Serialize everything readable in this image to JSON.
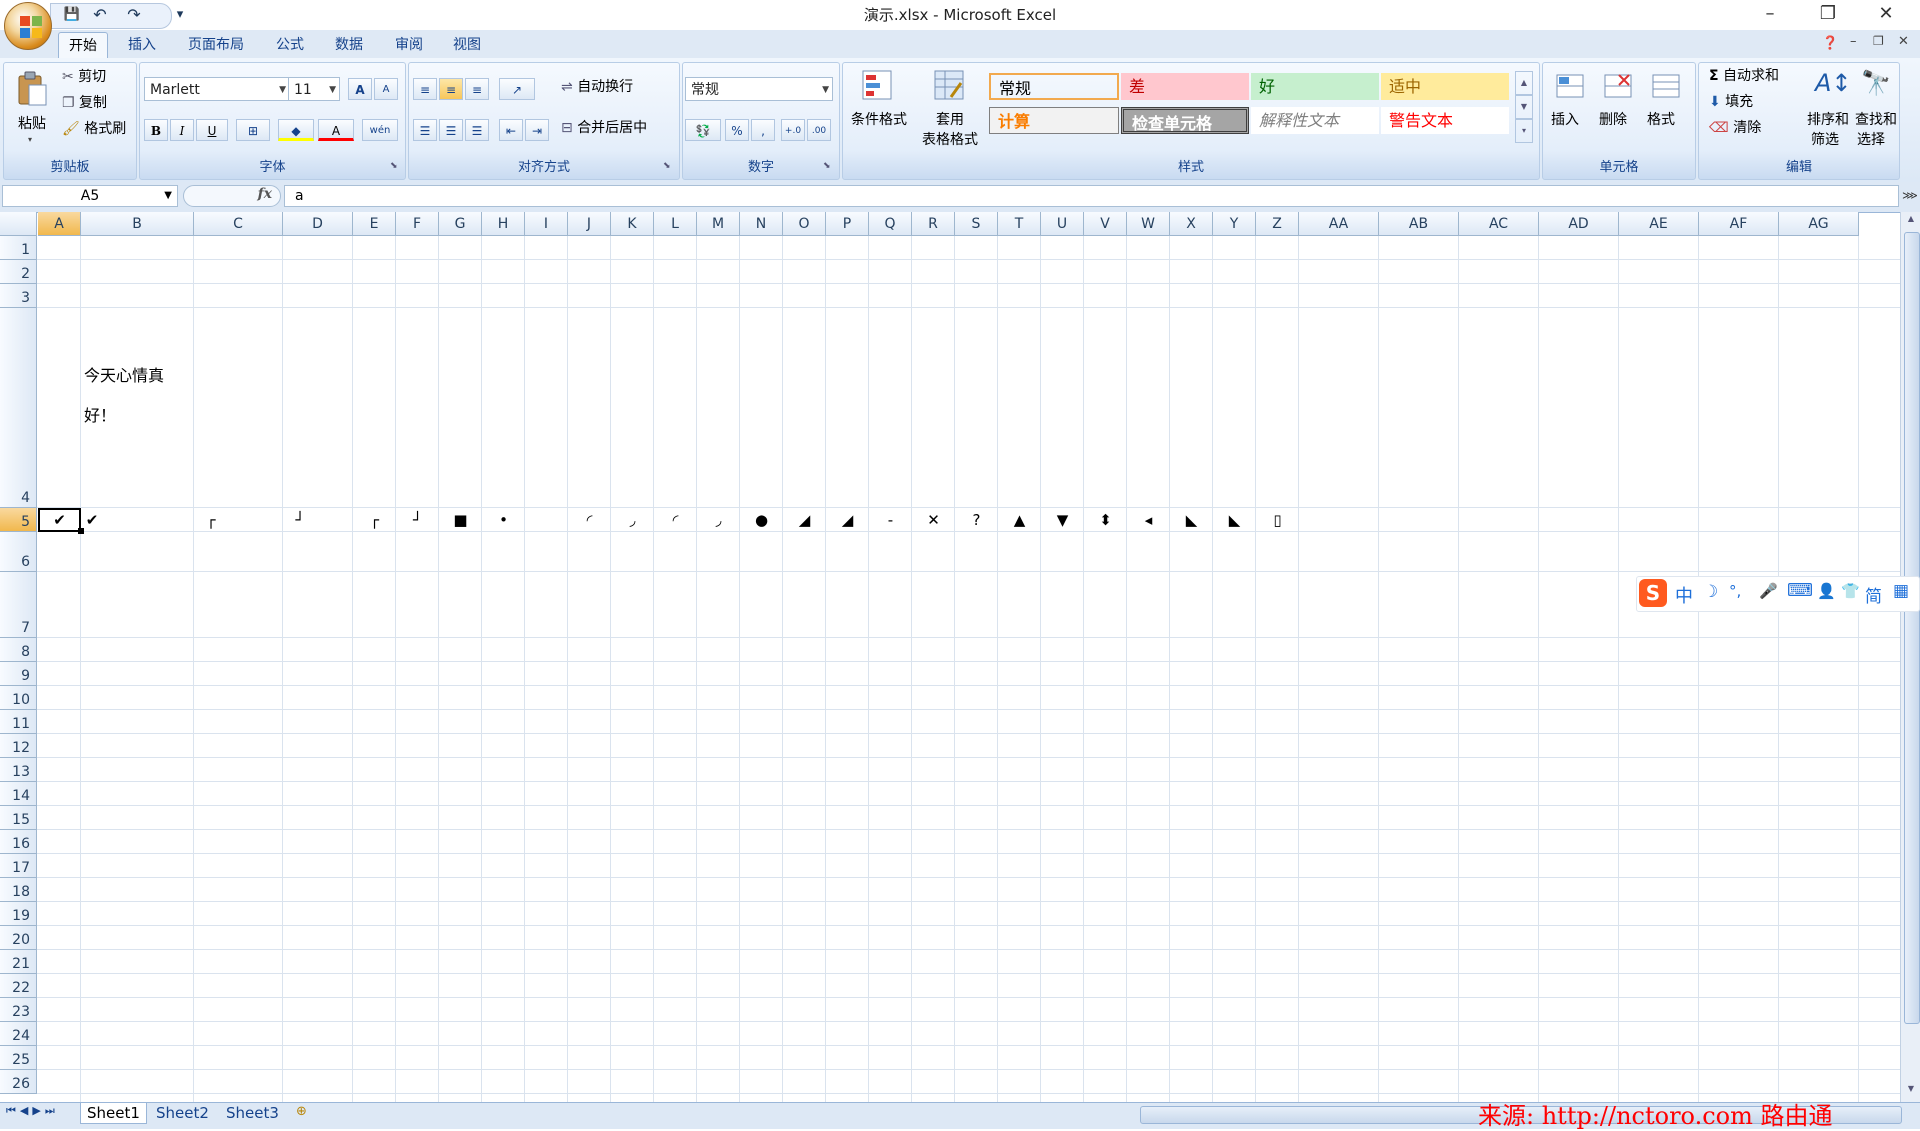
{
  "window": {
    "title": "演示.xlsx - Microsoft Excel",
    "controls": [
      "–",
      "❐",
      "✕"
    ]
  },
  "qat": {
    "save": "💾",
    "undo": "↶",
    "redo": "↷",
    "more": "▾"
  },
  "tabs": [
    "开始",
    "插入",
    "页面布局",
    "公式",
    "数据",
    "审阅",
    "视图"
  ],
  "ribbon": {
    "clipboard": {
      "label": "剪贴板",
      "paste": "粘贴",
      "cut": "剪切",
      "copy": "复制",
      "painter": "格式刷"
    },
    "font": {
      "label": "字体",
      "name": "Marlett",
      "size": "11",
      "bold": "B",
      "italic": "I",
      "underline": "U",
      "grow": "A",
      "shrink": "A",
      "color": "A",
      "phonetic": "wén"
    },
    "alignment": {
      "label": "对齐方式",
      "wrap": "自动换行",
      "merge": "合并后居中"
    },
    "number": {
      "label": "数字",
      "format": "常规",
      "percent": "%",
      "comma": ",",
      "inc": "+.0",
      "dec": ".00"
    },
    "styles": {
      "label": "样式",
      "conditional": "条件格式",
      "table": "套用",
      "table2": "表格格式",
      "cells": [
        {
          "text": "常规",
          "bg": "#ffffff",
          "color": "#000000"
        },
        {
          "text": "差",
          "bg": "#ffc7ce",
          "color": "#c00000"
        },
        {
          "text": "好",
          "bg": "#c6efce",
          "color": "#006100"
        },
        {
          "text": "适中",
          "bg": "#ffeb9c",
          "color": "#9c6500"
        },
        {
          "text": "计算",
          "bg": "#f2f2f2",
          "color": "#fa7d00"
        },
        {
          "text": "检查单元格",
          "bg": "#a5a5a5",
          "color": "#ffffff"
        },
        {
          "text": "解释性文本",
          "bg": "#ffffff",
          "color": "#7f7f7f"
        },
        {
          "text": "警告文本",
          "bg": "#ffffff",
          "color": "#ff0000"
        }
      ]
    },
    "cells": {
      "label": "单元格",
      "insert": "插入",
      "delete": "删除",
      "format": "格式"
    },
    "editing": {
      "label": "编辑",
      "autosum": "自动求和",
      "fill": "填充",
      "clear": "清除",
      "sort": "排序和",
      "sort2": "筛选",
      "find": "查找和",
      "find2": "选择"
    }
  },
  "formula": {
    "cell_ref": "A5",
    "fx": "fx",
    "value": "a"
  },
  "columns": [
    "A",
    "B",
    "C",
    "D",
    "E",
    "F",
    "G",
    "H",
    "I",
    "J",
    "K",
    "L",
    "M",
    "N",
    "O",
    "P",
    "Q",
    "R",
    "S",
    "T",
    "U",
    "V",
    "W",
    "X",
    "Y",
    "Z",
    "AA",
    "AB",
    "AC",
    "AD",
    "AE",
    "AF",
    "AG"
  ],
  "rows": [
    "1",
    "2",
    "3",
    "4",
    "5",
    "6",
    "7",
    "8",
    "9",
    "10",
    "11",
    "12",
    "13",
    "14",
    "15",
    "16",
    "17",
    "18",
    "19",
    "20",
    "21",
    "22",
    "23",
    "24",
    "25",
    "26"
  ],
  "cells": {
    "b4_line1": "今天心情真",
    "b4_line2": "好！",
    "row5_symbols": [
      "✔",
      "✔",
      "┌",
      "┘",
      "┌",
      "┘",
      "■",
      "•",
      "◜",
      "◞",
      "◜",
      "◞",
      "●",
      "◢",
      "◢",
      "-",
      "✕",
      "?",
      "▲",
      "▼",
      "⬍",
      "◂",
      "◣",
      "◣",
      "▯"
    ]
  },
  "sheets": [
    "Sheet1",
    "Sheet2",
    "Sheet3"
  ],
  "watermark": "来源: http://nctoro.com 路由通",
  "ime": {
    "logo": "S",
    "lang": "中",
    "items": [
      "☽",
      "°,",
      "🎤",
      "⌨",
      "👤",
      "👕",
      "简",
      "▦"
    ]
  }
}
